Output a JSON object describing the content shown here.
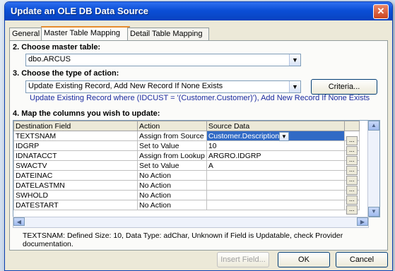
{
  "window": {
    "title": "Update an OLE DB Data Source",
    "close_glyph": "✕"
  },
  "tabs": [
    "General",
    "Master Table Mapping",
    "Detail Table Mapping"
  ],
  "step2": {
    "label": "2. Choose master table:",
    "value": "dbo.ARCUS"
  },
  "step3": {
    "label": "3. Choose the type of action:",
    "value": "Update Existing Record, Add New Record If None Exists",
    "criteria_button": "Criteria...",
    "description": "Update Existing Record where (IDCUST = '(Customer.Customer)'), Add New Record If None Exists"
  },
  "step4": {
    "label": "4. Map the columns you wish to update:"
  },
  "grid": {
    "headers": [
      "Destination Field",
      "Action",
      "Source Data"
    ],
    "rows": [
      [
        "TEXTSNAM",
        "Assign from Source",
        "Customer.Description"
      ],
      [
        "IDGRP",
        "Set to Value",
        "10"
      ],
      [
        "IDNATACCT",
        "Assign from Lookup",
        "ARGRO.IDGRP"
      ],
      [
        "SWACTV",
        "Set to Value",
        "A"
      ],
      [
        "DATEINAC",
        "No Action",
        ""
      ],
      [
        "DATELASTMN",
        "No Action",
        ""
      ],
      [
        "SWHOLD",
        "No Action",
        ""
      ],
      [
        "DATESTART",
        "No Action",
        ""
      ]
    ],
    "ellipsis": "..."
  },
  "info_text": "TEXTSNAM:  Defined Size: 10,  Data Type: adChar,  Unknown if Field is Updatable, check Provider documentation.",
  "buttons": {
    "insert_field": "Insert Field...",
    "ok": "OK",
    "cancel": "Cancel"
  },
  "colors": {
    "selection": "#316ac5",
    "title_bar": "#0b4fd6",
    "note": "#1a2aa0"
  }
}
